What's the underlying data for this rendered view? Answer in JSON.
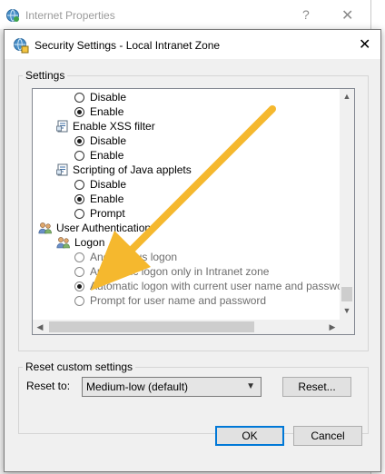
{
  "parent_window": {
    "title": "Internet Properties",
    "help_glyph": "?",
    "close_glyph": "✕"
  },
  "dialog": {
    "title": "Security Settings - Local Intranet Zone",
    "close_glyph": "✕",
    "settings_group_label": "Settings",
    "settings_items": [
      {
        "kind": "radio",
        "label": "Disable",
        "checked": false
      },
      {
        "kind": "radio",
        "label": "Enable",
        "checked": true
      },
      {
        "kind": "header",
        "label": "Enable XSS filter",
        "icon": "settings-page-icon"
      },
      {
        "kind": "radio",
        "label": "Disable",
        "checked": true
      },
      {
        "kind": "radio",
        "label": "Enable",
        "checked": false
      },
      {
        "kind": "header",
        "label": "Scripting of Java applets",
        "icon": "settings-page-icon"
      },
      {
        "kind": "radio",
        "label": "Disable",
        "checked": false
      },
      {
        "kind": "radio",
        "label": "Enable",
        "checked": true
      },
      {
        "kind": "radio",
        "label": "Prompt",
        "checked": false
      },
      {
        "kind": "category",
        "label": "User Authentication",
        "icon": "users-icon"
      },
      {
        "kind": "subheader",
        "label": "Logon",
        "icon": "users-icon"
      },
      {
        "kind": "radio",
        "label": "Anonymous logon",
        "checked": false,
        "disabled": true
      },
      {
        "kind": "radio",
        "label": "Automatic logon only in Intranet zone",
        "checked": false,
        "disabled": true
      },
      {
        "kind": "radio",
        "label": "Automatic logon with current user name and password",
        "checked": true,
        "disabled": true
      },
      {
        "kind": "radio",
        "label": "Prompt for user name and password",
        "checked": false,
        "disabled": true
      }
    ],
    "reset_group_label": "Reset custom settings",
    "reset_to_label": "Reset to:",
    "reset_select_value": "Medium-low (default)",
    "reset_button_label": "Reset...",
    "ok_label": "OK",
    "cancel_label": "Cancel"
  },
  "colors": {
    "arrow": "#f5b82e",
    "accent": "#0078d7"
  }
}
